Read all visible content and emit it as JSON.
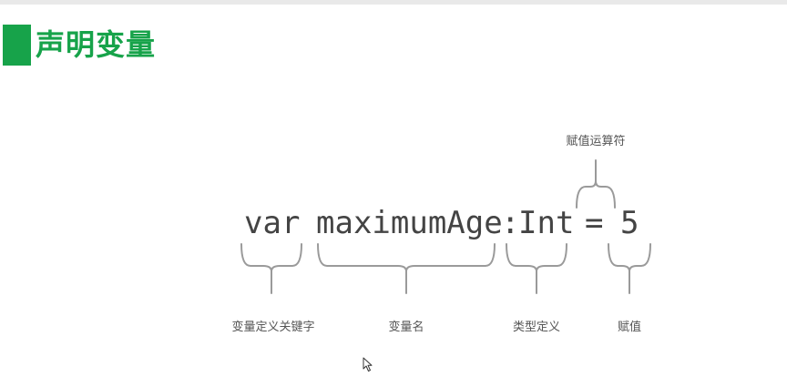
{
  "slide": {
    "title": "声明变量"
  },
  "code": {
    "keyword": "var",
    "name": "maximumAge",
    "colon": ":",
    "type": "Int",
    "operator": "=",
    "value": "5"
  },
  "labels": {
    "keyword": "变量定义关键字",
    "name": "变量名",
    "type": "类型定义",
    "value": "赋值",
    "operator": "赋值运算符"
  },
  "colors": {
    "accent": "#17a34a",
    "code_text": "#444444",
    "label_text": "#555555",
    "brace": "#9a9a9a"
  },
  "icons": {
    "cursor": "mouse-pointer-icon"
  }
}
